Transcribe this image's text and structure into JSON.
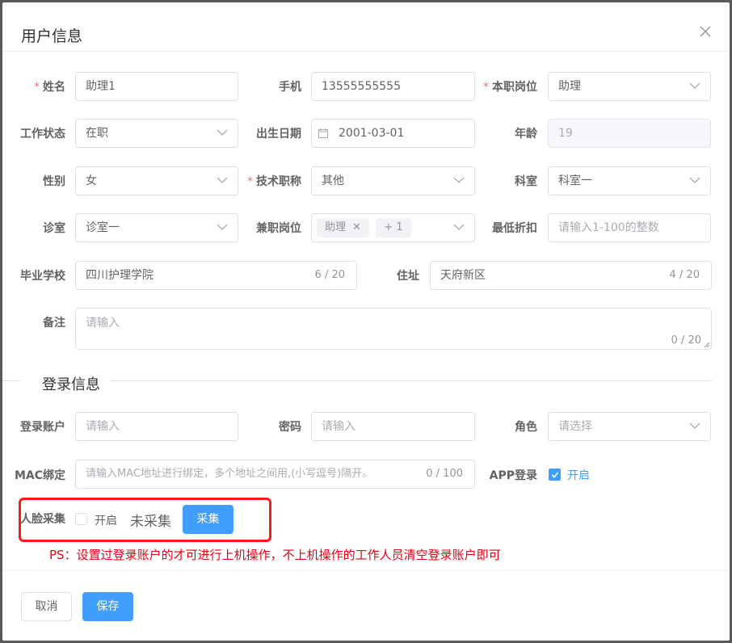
{
  "dialog": {
    "title": "用户信息",
    "close_icon": "close-icon"
  },
  "form": {
    "name": {
      "label": "姓名",
      "value": "助理1"
    },
    "phone": {
      "label": "手机",
      "value": "13555555555"
    },
    "main_post": {
      "label": "本职岗位",
      "value": "助理"
    },
    "work_status": {
      "label": "工作状态",
      "value": "在职"
    },
    "birthdate": {
      "label": "出生日期",
      "value": "2001-03-01"
    },
    "age": {
      "label": "年龄",
      "value": "19"
    },
    "gender": {
      "label": "性别",
      "value": "女"
    },
    "tech_title": {
      "label": "技术职称",
      "value": "其他"
    },
    "department": {
      "label": "科室",
      "value": "科室一"
    },
    "clinic": {
      "label": "诊室",
      "value": "诊室一"
    },
    "part_time_post": {
      "label": "兼职岗位",
      "tags": [
        "助理",
        "+ 1"
      ]
    },
    "min_discount": {
      "label": "最低折扣",
      "placeholder": "请输入1-100的整数"
    },
    "school": {
      "label": "毕业学校",
      "value": "四川护理学院",
      "counter": "6 / 20"
    },
    "address": {
      "label": "住址",
      "value": "天府新区",
      "counter": "4 / 20"
    },
    "remark": {
      "label": "备注",
      "placeholder": "请输入",
      "counter": "0 / 20"
    }
  },
  "login": {
    "section_title": "登录信息",
    "account": {
      "label": "登录账户",
      "placeholder": "请输入"
    },
    "password": {
      "label": "密码",
      "placeholder": "请输入"
    },
    "role": {
      "label": "角色",
      "placeholder": "请选择"
    },
    "mac": {
      "label": "MAC绑定",
      "placeholder": "请输入MAC地址进行绑定，多个地址之间用,(小写逗号)隔开。",
      "counter": "0 / 100"
    },
    "app_login": {
      "label": "APP登录",
      "option": "开启",
      "checked": true
    },
    "face": {
      "label": "人脸采集",
      "option": "开启",
      "checked": false,
      "status": "未采集",
      "button": "采集"
    }
  },
  "notice": "PS：设置过登录账户的才可进行上机操作，不上机操作的工作人员清空登录账户即可",
  "footer": {
    "cancel": "取消",
    "save": "保存"
  },
  "colors": {
    "primary": "#409eff",
    "required": "#f56c6c",
    "notice": "#e60012",
    "highlight_box": "#ff1a1a"
  }
}
